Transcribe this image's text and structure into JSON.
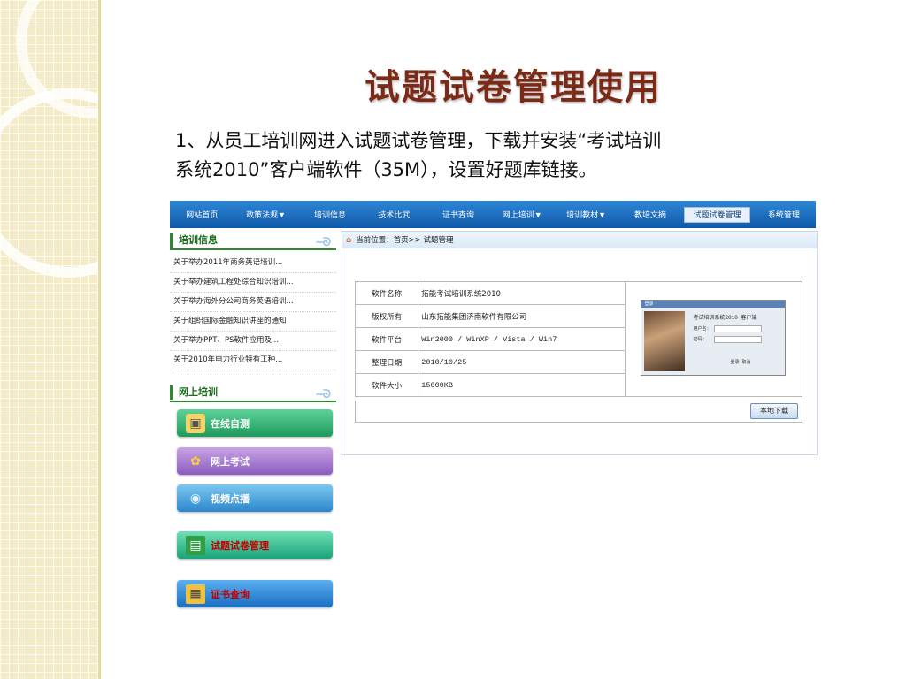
{
  "slide": {
    "title": "试题试卷管理使用",
    "desc_line1": "1、从员工培训网进入试题试卷管理，下载并安装“考试培训",
    "desc_line2": "系统2010”客户端软件（35M），设置好题库链接。"
  },
  "nav": {
    "items": [
      {
        "label": "网站首页"
      },
      {
        "label": "政策法规▼"
      },
      {
        "label": "培训信息"
      },
      {
        "label": "技术比武"
      },
      {
        "label": "证书查询"
      },
      {
        "label": "网上培训▼"
      },
      {
        "label": "培训教材▼"
      },
      {
        "label": "教培文摘"
      },
      {
        "label": "试题试卷管理"
      },
      {
        "label": "系统管理"
      }
    ]
  },
  "sidebar": {
    "panel1_title": "培训信息",
    "news": [
      "关于举办2011年商务英语培训...",
      "关于举办建筑工程处综合知识培训...",
      "关于举办海外分公司商务英语培训...",
      "关于组织国际金融知识讲座的通知",
      "关于举办PPT、PS软件应用及...",
      "关于2010年电力行业特有工种..."
    ],
    "panel2_title": "网上培训",
    "buttons": {
      "self_test": "在线自测",
      "online_exam": "网上考试",
      "video": "视频点播",
      "exam_manage": "试题试卷管理",
      "cert_query": "证书查询"
    }
  },
  "main": {
    "breadcrumb": "当前位置：首页>> 试题管理",
    "rows": [
      {
        "key": "软件名称",
        "value": "拓能考试培训系统2010"
      },
      {
        "key": "版权所有",
        "value": "山东拓能集团济南软件有限公司"
      },
      {
        "key": "软件平台",
        "value": "Win2000 / WinXP / Vista / Win7"
      },
      {
        "key": "整理日期",
        "value": "2010/10/25"
      },
      {
        "key": "软件大小",
        "value": "15000KB"
      }
    ],
    "thumb": {
      "title": "考试培训系统2010 客户端"
    },
    "download_label": "本地下载"
  },
  "icons": {
    "home": "home-icon",
    "swirl": "swirl-decoration-icon"
  }
}
